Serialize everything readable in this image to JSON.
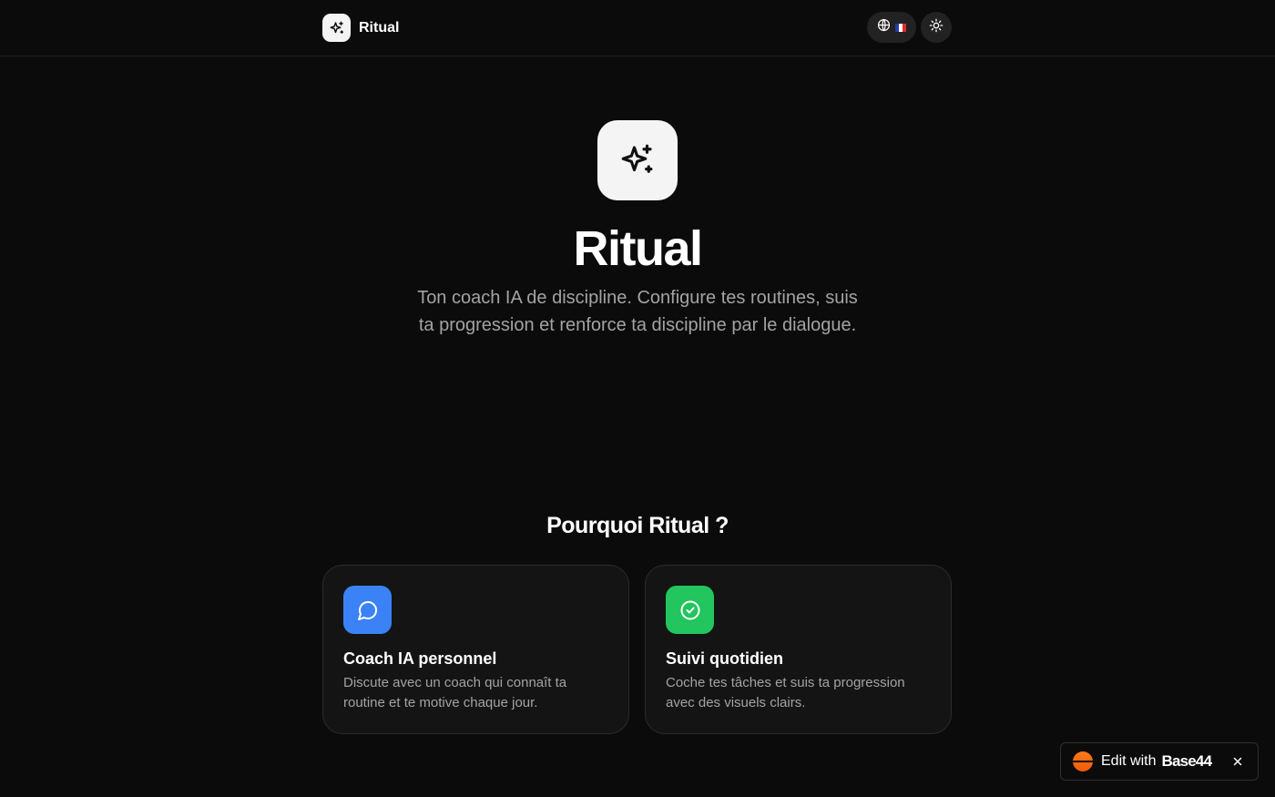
{
  "header": {
    "brand_name": "Ritual",
    "brand_icon": "sparkles-icon",
    "language_icon": "globe-icon",
    "language_flag_colors": [
      "#1f3fa0",
      "#ffffff",
      "#e32b2b"
    ],
    "theme_icon": "sun-icon"
  },
  "hero": {
    "icon": "sparkles-icon",
    "title": "Ritual",
    "subtitle": "Ton coach IA de discipline. Configure tes routines, suis ta progression et renforce ta discipline par le dialogue."
  },
  "features": {
    "title": "Pourquoi Ritual ?",
    "cards": [
      {
        "icon": "message-circle-icon",
        "icon_bg": "#3b82f6",
        "title": "Coach IA personnel",
        "description": "Discute avec un coach qui connaît ta routine et te motive chaque jour."
      },
      {
        "icon": "check-circle-icon",
        "icon_bg": "#22c55e",
        "title": "Suivi quotidien",
        "description": "Coche tes tâches et suis ta progression avec des visuels clairs."
      }
    ]
  },
  "edit_badge": {
    "label": "Edit with",
    "brand": "Base44",
    "accent": "#f26a10",
    "close_icon": "close-icon"
  }
}
